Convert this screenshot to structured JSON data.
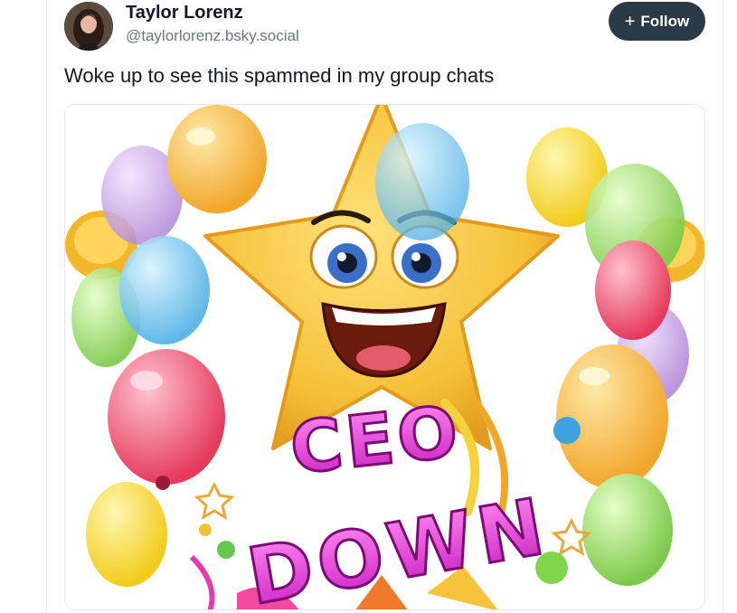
{
  "post": {
    "author": {
      "display_name": "Taylor Lorenz",
      "handle": "@taylorlorenz.bsky.social"
    },
    "follow_button": {
      "plus": "+",
      "label": "Follow"
    },
    "text": "Woke up to see this spammed in my group chats",
    "image": {
      "caption_line1": "CEO",
      "caption_line2": "DOWN"
    }
  },
  "colors": {
    "follow_bg": "#2a3a47",
    "handle_text": "#687684",
    "caption_magenta": "#e03ad6",
    "star_yellow": "#f7c843"
  }
}
